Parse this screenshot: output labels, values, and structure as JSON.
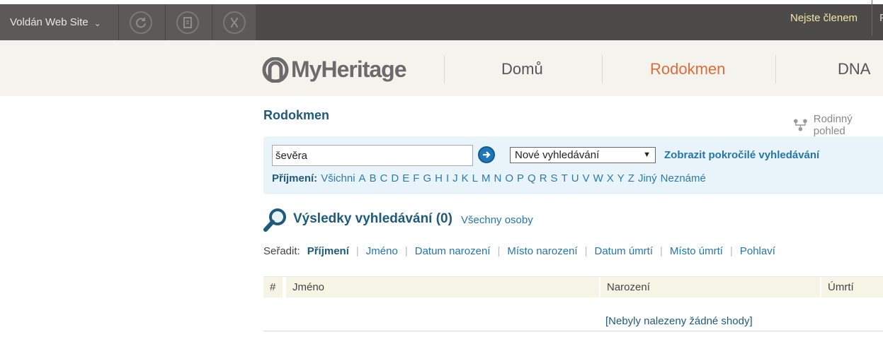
{
  "toolbar": {
    "site_name": "Voldán Web Site",
    "member_status": "Nejste členem",
    "cut_text": "F",
    "buttons": [
      "refresh-icon",
      "book-icon",
      "dna-icon"
    ]
  },
  "nav": {
    "brand": "MyHeritage",
    "items": [
      {
        "label": "Domů",
        "active": false
      },
      {
        "label": "Rodokmen",
        "active": true
      },
      {
        "label": "DNA",
        "active": false
      }
    ],
    "active_color": "#e06b3b"
  },
  "page": {
    "title": "Rodokmen",
    "family_view": "Rodinný pohled"
  },
  "search": {
    "value": "ševěra",
    "select_value": "Nové vyhledávání",
    "advanced_link": "Zobrazit pokročilé vyhledávání",
    "surname_label": "Příjmení:",
    "letters": [
      "Všichni",
      "A",
      "B",
      "C",
      "D",
      "E",
      "F",
      "G",
      "H",
      "I",
      "J",
      "K",
      "L",
      "M",
      "N",
      "O",
      "P",
      "Q",
      "R",
      "S",
      "T",
      "U",
      "V",
      "W",
      "X",
      "Y",
      "Z",
      "Jiný",
      "Neznámé"
    ]
  },
  "results": {
    "title": "Výsledky vyhledávání (0)",
    "all_persons": "Všechny osoby",
    "sort_label": "Seřadit:",
    "sort_options": [
      "Příjmení",
      "Jméno",
      "Datum narození",
      "Místo narození",
      "Datum úmrtí",
      "Místo úmrtí",
      "Pohlaví"
    ],
    "sort_active": "Příjmení",
    "columns": [
      "#",
      "Jméno",
      "Narození",
      "Úmrtí"
    ],
    "empty_message": "[Nebyly nalezeny žádné shody]"
  },
  "colors": {
    "toolbar": "#5c5a58",
    "navbar": "#f5f3ee",
    "title": "#1e5a7a",
    "link": "#2675a8",
    "panel": "#e8f3fa"
  }
}
